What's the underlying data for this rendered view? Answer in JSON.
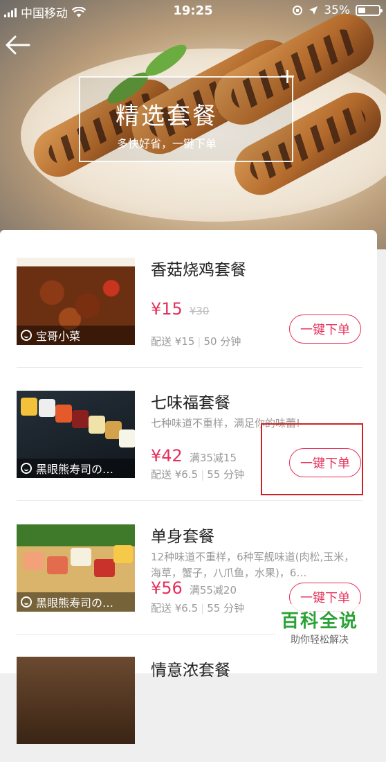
{
  "status_bar": {
    "carrier": "中国移动",
    "time": "19:25",
    "battery": "35%",
    "battery_level": 0.35
  },
  "hero": {
    "title": "精选套餐",
    "subtitle": "多快好省，一键下单"
  },
  "items": [
    {
      "name": "香菇烧鸡套餐",
      "desc": "",
      "price": "¥15",
      "old_price": "¥30",
      "promo": "",
      "delivery_fee": "配送 ¥15",
      "delivery_time": "50 分钟",
      "shop": "宝哥小菜",
      "button": "一键下单"
    },
    {
      "name": "七味福套餐",
      "desc": "七种味道不重样，满足你的味蕾!",
      "price": "¥42",
      "old_price": "",
      "promo": "满35减15",
      "delivery_fee": "配送 ¥6.5",
      "delivery_time": "55 分钟",
      "shop": "黑眼熊寿司の…",
      "button": "一键下单"
    },
    {
      "name": "单身套餐",
      "desc": "12种味道不重样，6种军舰味道(肉松,玉米，海草，蟹子，八爪鱼，水果)，6…",
      "price": "¥56",
      "old_price": "",
      "promo": "满55减20",
      "delivery_fee": "配送 ¥6.5",
      "delivery_time": "55 分钟",
      "shop": "黑眼熊寿司の…",
      "button": "一键下单"
    },
    {
      "name": "情意浓套餐"
    }
  ],
  "watermark": {
    "title": "百科全说",
    "subtitle": "助你轻松解决"
  }
}
